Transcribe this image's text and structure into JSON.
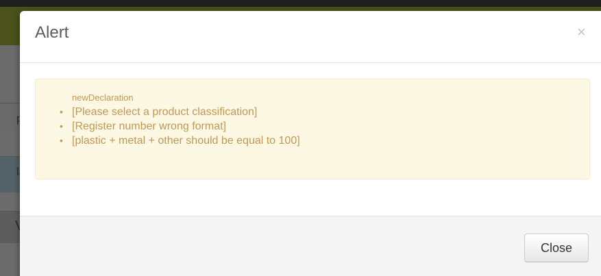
{
  "background": {
    "row1_text": "p",
    "row2_text": "lar",
    "row3_text": "Vi"
  },
  "modal": {
    "title": "Alert",
    "close_glyph": "×",
    "alert": {
      "heading": "newDeclaration",
      "bullet_glyph": "•",
      "items": [
        "[Please select a product classification]",
        "[Register number wrong format]",
        "[plastic + metal + other should be equal to 100]"
      ]
    },
    "footer": {
      "close_label": "Close"
    }
  },
  "colors": {
    "alert_text": "#c09853",
    "alert_background": "#fcf8e3",
    "title_text": "#555d66"
  }
}
